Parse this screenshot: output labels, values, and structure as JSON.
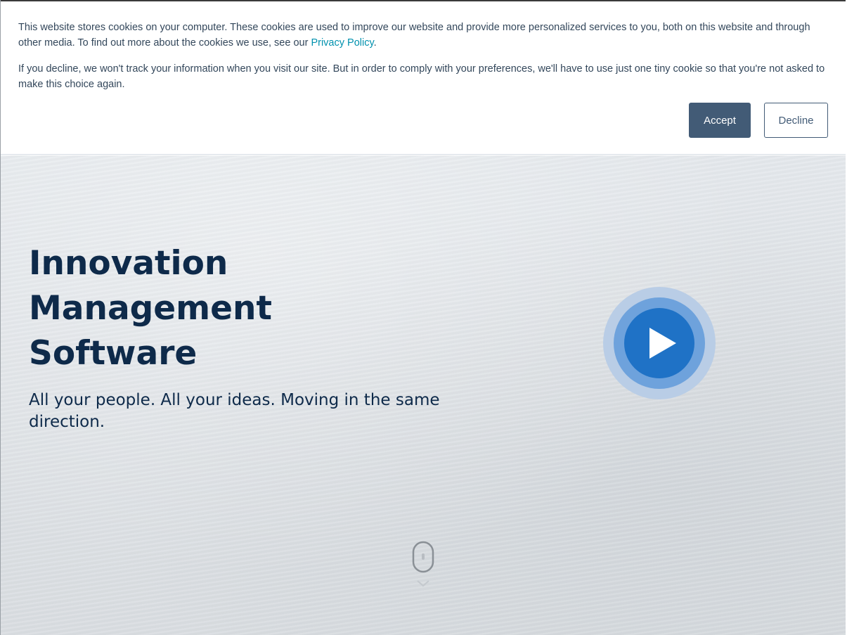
{
  "cookie_banner": {
    "paragraph1_text": "This website stores cookies on your computer. These cookies are used to improve our website and provide more personalized services to you, both on this website and through other media. To find out more about the cookies we use, see our ",
    "privacy_link": "Privacy Policy",
    "paragraph1_end": ".",
    "paragraph2_text": "If you decline, we won't track your information when you visit our site. But in order to comply with your preferences, we'll have to use just one tiny cookie so that you're not asked to make this choice again.",
    "accept_label": "Accept",
    "decline_label": "Decline"
  },
  "hero": {
    "title_lines": [
      "Innovation",
      "Management",
      "Software"
    ],
    "subtitle": "All your people. All your ideas. Moving in the same direction.",
    "play_icon": "play-icon",
    "scroll_icon": "mouse-scroll-icon"
  },
  "colors": {
    "accent_button": "#425b76",
    "link": "#0091ae",
    "title_text": "#0e2a4a",
    "play_blue": "#1f72c6"
  }
}
